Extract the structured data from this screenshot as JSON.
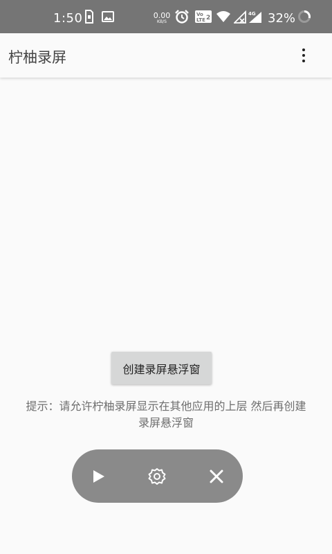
{
  "status_bar": {
    "time": "1:50",
    "net_speed_value": "0.00",
    "net_speed_unit": "KB/S",
    "battery_percent": "32%",
    "icons": [
      "sim-card-icon",
      "image-icon",
      "alarm-icon",
      "volte-icon",
      "wifi-icon",
      "signal-icon",
      "4g-signal-icon",
      "battery-ring-icon"
    ]
  },
  "app_bar": {
    "title": "柠柚录屏",
    "menu_icon": "more-vert-icon"
  },
  "main": {
    "create_button_label": "创建录屏悬浮窗",
    "hint_text": "提示：请允许柠柚录屏显示在其他应用的上层 然后再创建录屏悬浮窗"
  },
  "floating_panel": {
    "buttons": [
      "play-icon",
      "settings-icon",
      "close-icon"
    ]
  },
  "colors": {
    "status_bar_bg": "#757575",
    "app_bg": "#fafafa",
    "button_bg": "#d6d7d7",
    "panel_bg": "#8a8a8a"
  }
}
